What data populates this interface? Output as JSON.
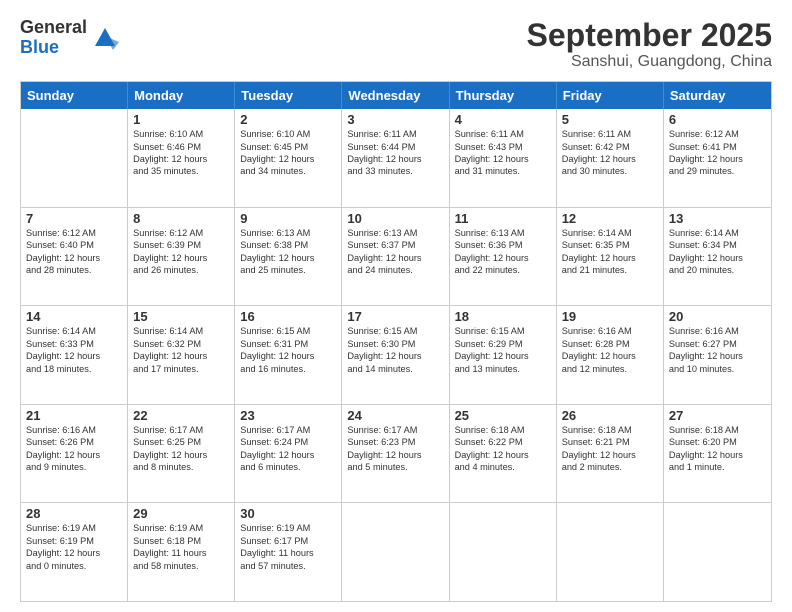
{
  "logo": {
    "general": "General",
    "blue": "Blue"
  },
  "title": "September 2025",
  "subtitle": "Sanshui, Guangdong, China",
  "days_of_week": [
    "Sunday",
    "Monday",
    "Tuesday",
    "Wednesday",
    "Thursday",
    "Friday",
    "Saturday"
  ],
  "weeks": [
    [
      {
        "day": "",
        "lines": []
      },
      {
        "day": "1",
        "lines": [
          "Sunrise: 6:10 AM",
          "Sunset: 6:46 PM",
          "Daylight: 12 hours",
          "and 35 minutes."
        ]
      },
      {
        "day": "2",
        "lines": [
          "Sunrise: 6:10 AM",
          "Sunset: 6:45 PM",
          "Daylight: 12 hours",
          "and 34 minutes."
        ]
      },
      {
        "day": "3",
        "lines": [
          "Sunrise: 6:11 AM",
          "Sunset: 6:44 PM",
          "Daylight: 12 hours",
          "and 33 minutes."
        ]
      },
      {
        "day": "4",
        "lines": [
          "Sunrise: 6:11 AM",
          "Sunset: 6:43 PM",
          "Daylight: 12 hours",
          "and 31 minutes."
        ]
      },
      {
        "day": "5",
        "lines": [
          "Sunrise: 6:11 AM",
          "Sunset: 6:42 PM",
          "Daylight: 12 hours",
          "and 30 minutes."
        ]
      },
      {
        "day": "6",
        "lines": [
          "Sunrise: 6:12 AM",
          "Sunset: 6:41 PM",
          "Daylight: 12 hours",
          "and 29 minutes."
        ]
      }
    ],
    [
      {
        "day": "7",
        "lines": [
          "Sunrise: 6:12 AM",
          "Sunset: 6:40 PM",
          "Daylight: 12 hours",
          "and 28 minutes."
        ]
      },
      {
        "day": "8",
        "lines": [
          "Sunrise: 6:12 AM",
          "Sunset: 6:39 PM",
          "Daylight: 12 hours",
          "and 26 minutes."
        ]
      },
      {
        "day": "9",
        "lines": [
          "Sunrise: 6:13 AM",
          "Sunset: 6:38 PM",
          "Daylight: 12 hours",
          "and 25 minutes."
        ]
      },
      {
        "day": "10",
        "lines": [
          "Sunrise: 6:13 AM",
          "Sunset: 6:37 PM",
          "Daylight: 12 hours",
          "and 24 minutes."
        ]
      },
      {
        "day": "11",
        "lines": [
          "Sunrise: 6:13 AM",
          "Sunset: 6:36 PM",
          "Daylight: 12 hours",
          "and 22 minutes."
        ]
      },
      {
        "day": "12",
        "lines": [
          "Sunrise: 6:14 AM",
          "Sunset: 6:35 PM",
          "Daylight: 12 hours",
          "and 21 minutes."
        ]
      },
      {
        "day": "13",
        "lines": [
          "Sunrise: 6:14 AM",
          "Sunset: 6:34 PM",
          "Daylight: 12 hours",
          "and 20 minutes."
        ]
      }
    ],
    [
      {
        "day": "14",
        "lines": [
          "Sunrise: 6:14 AM",
          "Sunset: 6:33 PM",
          "Daylight: 12 hours",
          "and 18 minutes."
        ]
      },
      {
        "day": "15",
        "lines": [
          "Sunrise: 6:14 AM",
          "Sunset: 6:32 PM",
          "Daylight: 12 hours",
          "and 17 minutes."
        ]
      },
      {
        "day": "16",
        "lines": [
          "Sunrise: 6:15 AM",
          "Sunset: 6:31 PM",
          "Daylight: 12 hours",
          "and 16 minutes."
        ]
      },
      {
        "day": "17",
        "lines": [
          "Sunrise: 6:15 AM",
          "Sunset: 6:30 PM",
          "Daylight: 12 hours",
          "and 14 minutes."
        ]
      },
      {
        "day": "18",
        "lines": [
          "Sunrise: 6:15 AM",
          "Sunset: 6:29 PM",
          "Daylight: 12 hours",
          "and 13 minutes."
        ]
      },
      {
        "day": "19",
        "lines": [
          "Sunrise: 6:16 AM",
          "Sunset: 6:28 PM",
          "Daylight: 12 hours",
          "and 12 minutes."
        ]
      },
      {
        "day": "20",
        "lines": [
          "Sunrise: 6:16 AM",
          "Sunset: 6:27 PM",
          "Daylight: 12 hours",
          "and 10 minutes."
        ]
      }
    ],
    [
      {
        "day": "21",
        "lines": [
          "Sunrise: 6:16 AM",
          "Sunset: 6:26 PM",
          "Daylight: 12 hours",
          "and 9 minutes."
        ]
      },
      {
        "day": "22",
        "lines": [
          "Sunrise: 6:17 AM",
          "Sunset: 6:25 PM",
          "Daylight: 12 hours",
          "and 8 minutes."
        ]
      },
      {
        "day": "23",
        "lines": [
          "Sunrise: 6:17 AM",
          "Sunset: 6:24 PM",
          "Daylight: 12 hours",
          "and 6 minutes."
        ]
      },
      {
        "day": "24",
        "lines": [
          "Sunrise: 6:17 AM",
          "Sunset: 6:23 PM",
          "Daylight: 12 hours",
          "and 5 minutes."
        ]
      },
      {
        "day": "25",
        "lines": [
          "Sunrise: 6:18 AM",
          "Sunset: 6:22 PM",
          "Daylight: 12 hours",
          "and 4 minutes."
        ]
      },
      {
        "day": "26",
        "lines": [
          "Sunrise: 6:18 AM",
          "Sunset: 6:21 PM",
          "Daylight: 12 hours",
          "and 2 minutes."
        ]
      },
      {
        "day": "27",
        "lines": [
          "Sunrise: 6:18 AM",
          "Sunset: 6:20 PM",
          "Daylight: 12 hours",
          "and 1 minute."
        ]
      }
    ],
    [
      {
        "day": "28",
        "lines": [
          "Sunrise: 6:19 AM",
          "Sunset: 6:19 PM",
          "Daylight: 12 hours",
          "and 0 minutes."
        ]
      },
      {
        "day": "29",
        "lines": [
          "Sunrise: 6:19 AM",
          "Sunset: 6:18 PM",
          "Daylight: 11 hours",
          "and 58 minutes."
        ]
      },
      {
        "day": "30",
        "lines": [
          "Sunrise: 6:19 AM",
          "Sunset: 6:17 PM",
          "Daylight: 11 hours",
          "and 57 minutes."
        ]
      },
      {
        "day": "",
        "lines": []
      },
      {
        "day": "",
        "lines": []
      },
      {
        "day": "",
        "lines": []
      },
      {
        "day": "",
        "lines": []
      }
    ]
  ]
}
